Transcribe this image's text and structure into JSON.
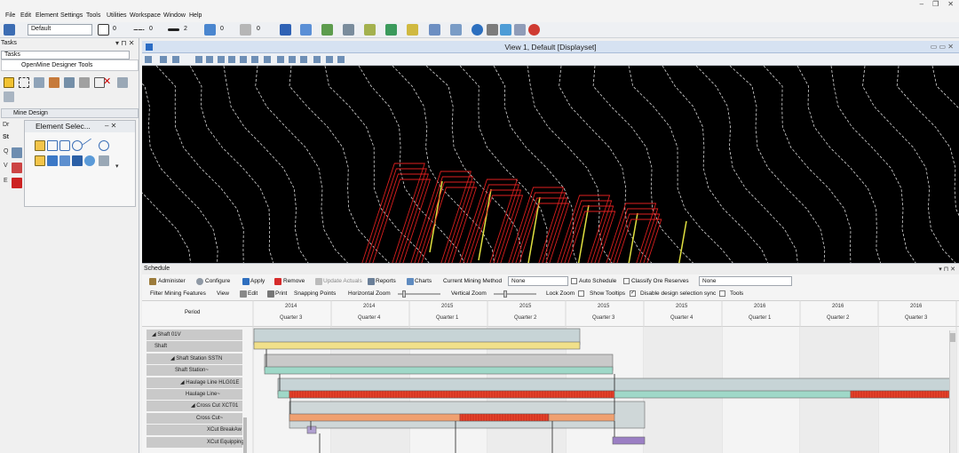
{
  "menu": [
    "File",
    "Edit",
    "Element",
    "Settings",
    "Tools",
    "Utilities",
    "Workspace",
    "Window",
    "Help"
  ],
  "toolbar": {
    "level_combo": "Default",
    "color_value": "0",
    "style_value": "0",
    "weight_value": "2",
    "transparency_value": "0",
    "priority_value": "0"
  },
  "left": {
    "tasks_title": "Tasks",
    "tasks_combo": "Tasks",
    "openmine": "OpenMine Designer Tools",
    "mine_design": "Mine Design",
    "element_select": "Element Selec...",
    "tab1": "Dr",
    "tab2": "St",
    "letters": [
      "Q",
      "V",
      "E"
    ]
  },
  "view": {
    "title": "View 1, Default [Displayset]"
  },
  "schedule": {
    "title": "Schedule",
    "row1": {
      "administer": "Administer",
      "configure": "Configure",
      "apply": "Apply",
      "remove": "Remove",
      "update_actuals": "Update Actuals",
      "reports": "Reports",
      "charts": "Charts",
      "method_label": "Current Mining Method",
      "method_value": "None",
      "auto_schedule": "Auto Schedule",
      "classify": "Classify Ore Reserves",
      "classify_value": "None"
    },
    "row2": {
      "filter": "Filter Mining Features",
      "view": "View",
      "edit": "Edit",
      "print": "Print",
      "snapping": "Snapping Points",
      "hzoom": "Horizontal Zoom",
      "vzoom": "Vertical Zoom",
      "lockzoom": "Lock Zoom",
      "tooltips": "Show Tooltips",
      "disable_sync": "Disable design selection sync",
      "tools": "Tools"
    },
    "period_label": "Period",
    "columns": [
      {
        "year": "2014",
        "quarter": "Quarter 3"
      },
      {
        "year": "2014",
        "quarter": "Quarter 4"
      },
      {
        "year": "2015",
        "quarter": "Quarter 1"
      },
      {
        "year": "2015",
        "quarter": "Quarter 2"
      },
      {
        "year": "2015",
        "quarter": "Quarter 3"
      },
      {
        "year": "2015",
        "quarter": "Quarter 4"
      },
      {
        "year": "2016",
        "quarter": "Quarter 1"
      },
      {
        "year": "2016",
        "quarter": "Quarter 2"
      },
      {
        "year": "2016",
        "quarter": "Quarter 3"
      }
    ],
    "tree": [
      "◢ Shaft 01V",
      "Shaft",
      "◢ Shaft Station SSTN",
      "Shaft Station~",
      "◢ Haulage Line HLG01E",
      "Haulage Line~",
      "◢ Cross Cut XCT01",
      "Cross Cut~",
      "XCut BreakAw",
      "XCut Equipping"
    ]
  },
  "colors": {
    "accent": "#2b6cc4",
    "contour": "#d8d8d8",
    "stope": "#e02020",
    "bar_yellow": "#f1e08a",
    "bar_teal": "#9fd8c8",
    "bar_red": "#e5432b",
    "bar_orange": "#f0a070",
    "bar_purple": "#9b7fc4"
  }
}
